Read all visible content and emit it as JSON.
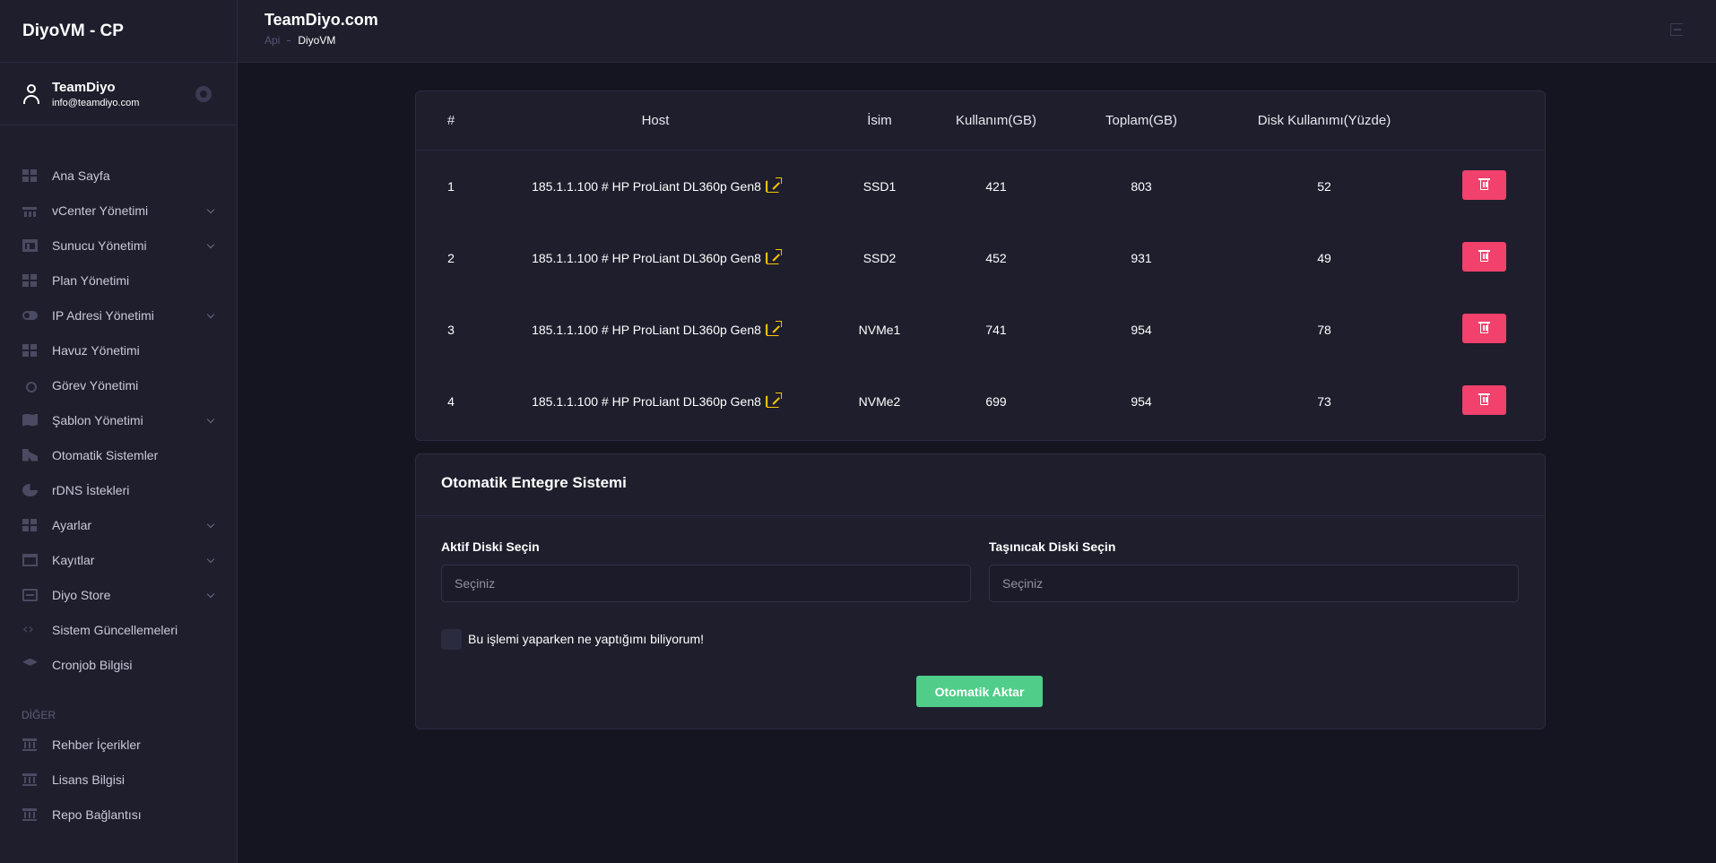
{
  "app": {
    "brand": "DiyoVM - CP"
  },
  "user": {
    "name": "TeamDiyo",
    "email": "info@teamdiyo.com"
  },
  "sidebar": {
    "items": [
      {
        "label": "Ana Sayfa",
        "icon": "grid-icon",
        "has_submenu": false
      },
      {
        "label": "vCenter Yönetimi",
        "icon": "server-rack-icon",
        "has_submenu": true
      },
      {
        "label": "Sunucu Yönetimi",
        "icon": "layout-icon",
        "has_submenu": true
      },
      {
        "label": "Plan Yönetimi",
        "icon": "grid-icon",
        "has_submenu": false
      },
      {
        "label": "IP Adresi Yönetimi",
        "icon": "toggle-icon",
        "has_submenu": true
      },
      {
        "label": "Havuz Yönetimi",
        "icon": "grid-icon",
        "has_submenu": false
      },
      {
        "label": "Görev Yönetimi",
        "icon": "target-icon",
        "has_submenu": false
      },
      {
        "label": "Şablon Yönetimi",
        "icon": "map-icon",
        "has_submenu": true
      },
      {
        "label": "Otomatik Sistemler",
        "icon": "brush-icon",
        "has_submenu": false
      },
      {
        "label": "rDNS İstekleri",
        "icon": "pie-chart-icon",
        "has_submenu": false
      },
      {
        "label": "Ayarlar",
        "icon": "grid-icon",
        "has_submenu": true
      },
      {
        "label": "Kayıtlar",
        "icon": "calendar-icon",
        "has_submenu": true
      },
      {
        "label": "Diyo Store",
        "icon": "store-icon",
        "has_submenu": true
      },
      {
        "label": "Sistem Güncellemeleri",
        "icon": "code-icon",
        "has_submenu": false
      },
      {
        "label": "Cronjob Bilgisi",
        "icon": "stack-icon",
        "has_submenu": false
      }
    ],
    "section_label": "DİĞER",
    "other_items": [
      {
        "label": "Rehber İçerikler",
        "icon": "bank-icon"
      },
      {
        "label": "Lisans Bilgisi",
        "icon": "bank-icon"
      },
      {
        "label": "Repo Bağlantısı",
        "icon": "bank-icon"
      }
    ]
  },
  "header": {
    "title": "TeamDiyo.com",
    "breadcrumb": [
      "Api",
      "DiyoVM"
    ]
  },
  "table": {
    "columns": [
      "#",
      "Host",
      "İsim",
      "Kullanım(GB)",
      "Toplam(GB)",
      "Disk Kullanımı(Yüzde)"
    ],
    "rows": [
      {
        "num": "1",
        "host": "185.1.1.100 # HP ProLiant DL360p Gen8",
        "name": "SSD1",
        "used": "421",
        "total": "803",
        "percent": "52"
      },
      {
        "num": "2",
        "host": "185.1.1.100 # HP ProLiant DL360p Gen8",
        "name": "SSD2",
        "used": "452",
        "total": "931",
        "percent": "49"
      },
      {
        "num": "3",
        "host": "185.1.1.100 # HP ProLiant DL360p Gen8",
        "name": "NVMe1",
        "used": "741",
        "total": "954",
        "percent": "78"
      },
      {
        "num": "4",
        "host": "185.1.1.100 # HP ProLiant DL360p Gen8",
        "name": "NVMe2",
        "used": "699",
        "total": "954",
        "percent": "73"
      }
    ]
  },
  "form": {
    "title": "Otomatik Entegre Sistemi",
    "active_disk_label": "Aktif Diski Seçin",
    "target_disk_label": "Taşınıcak Diski Seçin",
    "select_placeholder": "Seçiniz",
    "confirm_label": "Bu işlemi yaparken ne yaptığımı biliyorum!",
    "confirm_checked": false,
    "submit_label": "Otomatik Aktar"
  },
  "colors": {
    "background": "#151521",
    "panel": "#1e1e2d",
    "danger": "#f1416c",
    "success": "#50cd89",
    "link_icon": "#ffc700"
  }
}
